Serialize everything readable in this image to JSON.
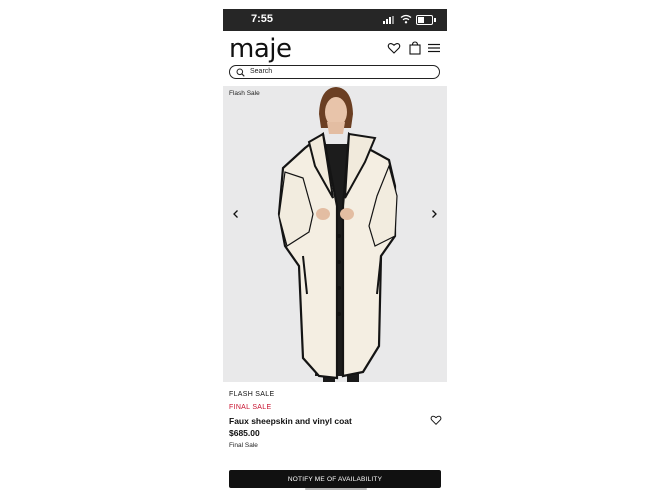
{
  "status_bar": {
    "time": "7:55"
  },
  "header": {
    "logo_text": "maje",
    "icons": [
      "heart-icon",
      "shopping-bag-icon",
      "menu-icon"
    ]
  },
  "search": {
    "placeholder": "Search"
  },
  "hero": {
    "tag": "Flash Sale",
    "image_alt": "Model wearing faux sheepskin and vinyl coat"
  },
  "product": {
    "category": "FLASH SALE",
    "sale_label": "FINAL SALE",
    "name": "Faux sheepskin and vinyl coat",
    "price": "$685.00",
    "note": "Final Sale"
  },
  "cta": {
    "label": "NOTIFY ME OF AVAILABILITY"
  },
  "colors": {
    "sale_red": "#c8102e",
    "button_black": "#111111",
    "statusbar": "#262626"
  }
}
